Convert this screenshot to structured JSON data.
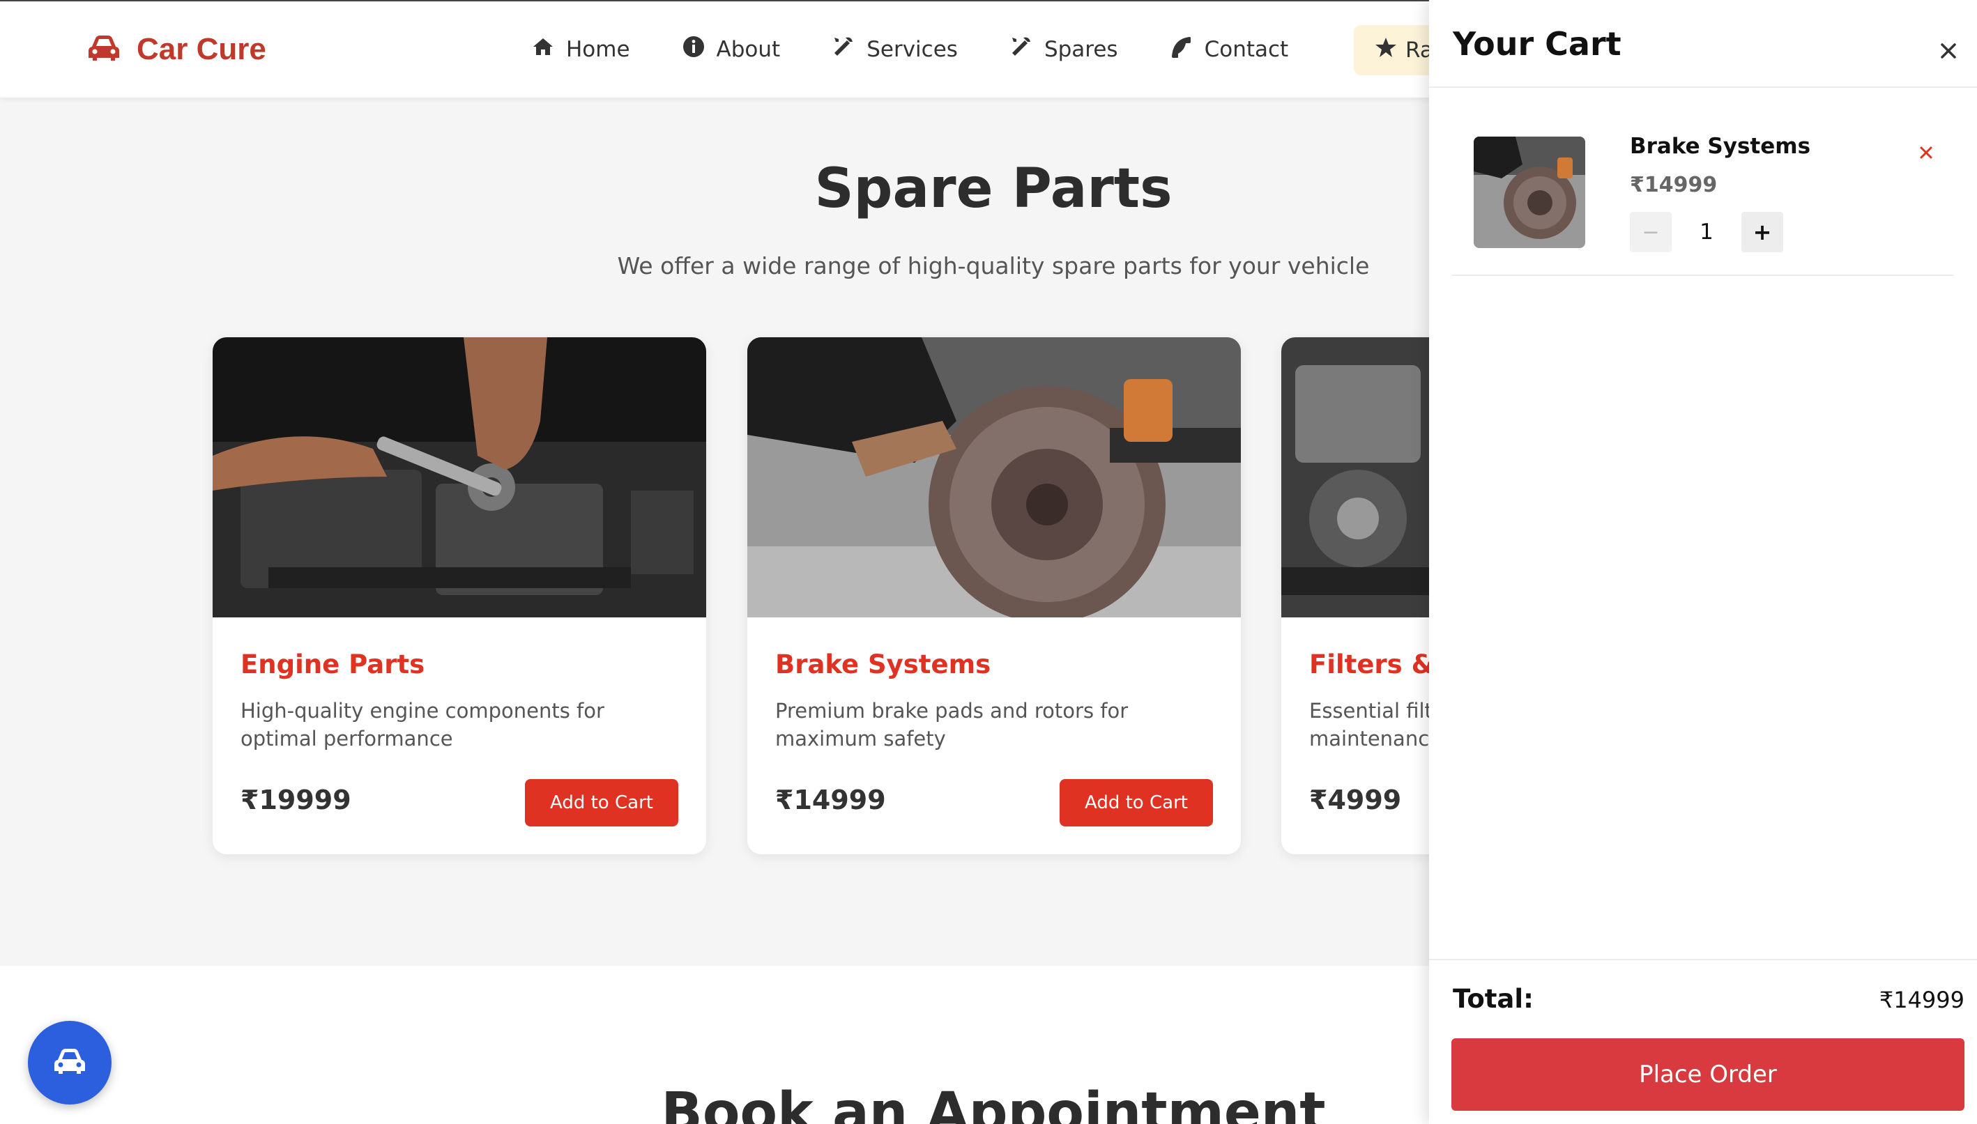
{
  "brand": {
    "name": "Car Cure",
    "icon": "car-icon",
    "color": "#c0392b"
  },
  "nav": [
    {
      "label": "Home",
      "icon": "home-icon"
    },
    {
      "label": "About",
      "icon": "info-icon"
    },
    {
      "label": "Services",
      "icon": "tools-icon"
    },
    {
      "label": "Spares",
      "icon": "tools-icon"
    },
    {
      "label": "Contact",
      "icon": "phone-icon"
    }
  ],
  "rate_button": {
    "label": "Ra",
    "icon": "star-icon"
  },
  "spares": {
    "title": "Spare Parts",
    "subtitle": "We offer a wide range of high-quality spare parts for your vehicle",
    "cards": [
      {
        "title": "Engine Parts",
        "description": "High-quality engine components for optimal performance",
        "price": "₹19999",
        "button": "Add to Cart"
      },
      {
        "title": "Brake Systems",
        "description": "Premium brake pads and rotors for maximum safety",
        "price": "₹14999",
        "button": "Add to Cart"
      },
      {
        "title": "Filters & O",
        "description": "Essential filt maintenanc",
        "price": "₹4999",
        "button": ""
      }
    ]
  },
  "appointment": {
    "title": "Book an Appointment"
  },
  "cart": {
    "title": "Your Cart",
    "items": [
      {
        "name": "Brake Systems",
        "price": "₹14999",
        "quantity": "1",
        "minus": "−",
        "plus": "+"
      }
    ],
    "total_label": "Total:",
    "total_value": "₹14999",
    "place_order": "Place Order"
  },
  "colors": {
    "accent": "#e03222",
    "place_order": "#d93a3f",
    "fab": "#2c5fde"
  }
}
